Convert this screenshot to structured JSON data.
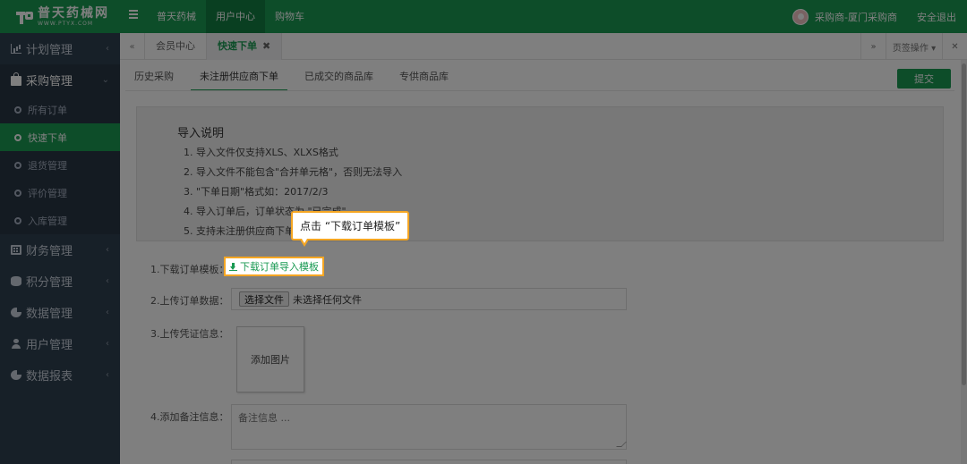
{
  "brand": {
    "name_cn": "普天药械网",
    "name_en": "WWW.PTYX.COM"
  },
  "topnav": {
    "items": [
      "普天药械",
      "用户中心",
      "购物车"
    ],
    "active_index": 1
  },
  "user": {
    "name": "采购商-厦门采购商",
    "logout": "安全退出"
  },
  "sidebar": {
    "groups": [
      {
        "label": "计划管理",
        "icon": "bar-chart-icon",
        "arrow": "‹"
      },
      {
        "label": "采购管理",
        "icon": "shopping-bag-icon",
        "arrow": "⌄",
        "open": true
      },
      {
        "label": "财务管理",
        "icon": "calculator-icon",
        "arrow": "‹"
      },
      {
        "label": "积分管理",
        "icon": "database-icon",
        "arrow": "‹"
      },
      {
        "label": "数据管理",
        "icon": "pie-chart-icon",
        "arrow": "‹"
      },
      {
        "label": "用户管理",
        "icon": "user-icon",
        "arrow": "‹"
      },
      {
        "label": "数据报表",
        "icon": "pie-chart-icon",
        "arrow": "‹"
      }
    ],
    "sub_items": [
      "所有订单",
      "快速下单",
      "退货管理",
      "评价管理",
      "入库管理"
    ],
    "active_sub_index": 1
  },
  "tabbar": {
    "back": "«",
    "tabs": [
      {
        "label": "会员中心"
      },
      {
        "label": "快速下单",
        "close": "✖"
      }
    ],
    "forward": "»",
    "page_ops": "页签操作 ▾",
    "close_all": "✕"
  },
  "main": {
    "subtabs": [
      "历史采购",
      "未注册供应商下单",
      "已成交的商品库",
      "专供商品库"
    ],
    "active_subtab_index": 1,
    "submit": "提交",
    "notice": {
      "title": "导入说明",
      "items": [
        "1. 导入文件仅支持XLS、XLXS格式",
        "2. 导入文件不能包含\"合并单元格\"，否则无法导入",
        "3. \"下单日期\"格式如：2017/2/3",
        "4. 导入订单后，订单状态为 \"已完成\"",
        "5. 支持未注册供应商下单"
      ]
    },
    "form": {
      "download_label": "1.下载订单模板：",
      "download_link": "下载订单导入模板",
      "upload_label": "2.上传订单数据：",
      "file_button": "选择文件",
      "file_status": "未选择任何文件",
      "voucher_label": "3.上传凭证信息：",
      "add_image": "添加图片",
      "remark_label": "4.添加备注信息：",
      "remark_placeholder": "备注信息 ..."
    }
  },
  "tooltip": {
    "text": "点击 “下载订单模板”"
  },
  "colors": {
    "brand_green": "#1a9a53",
    "sidebar_bg": "#2f4050",
    "highlight": "#f5a623"
  }
}
